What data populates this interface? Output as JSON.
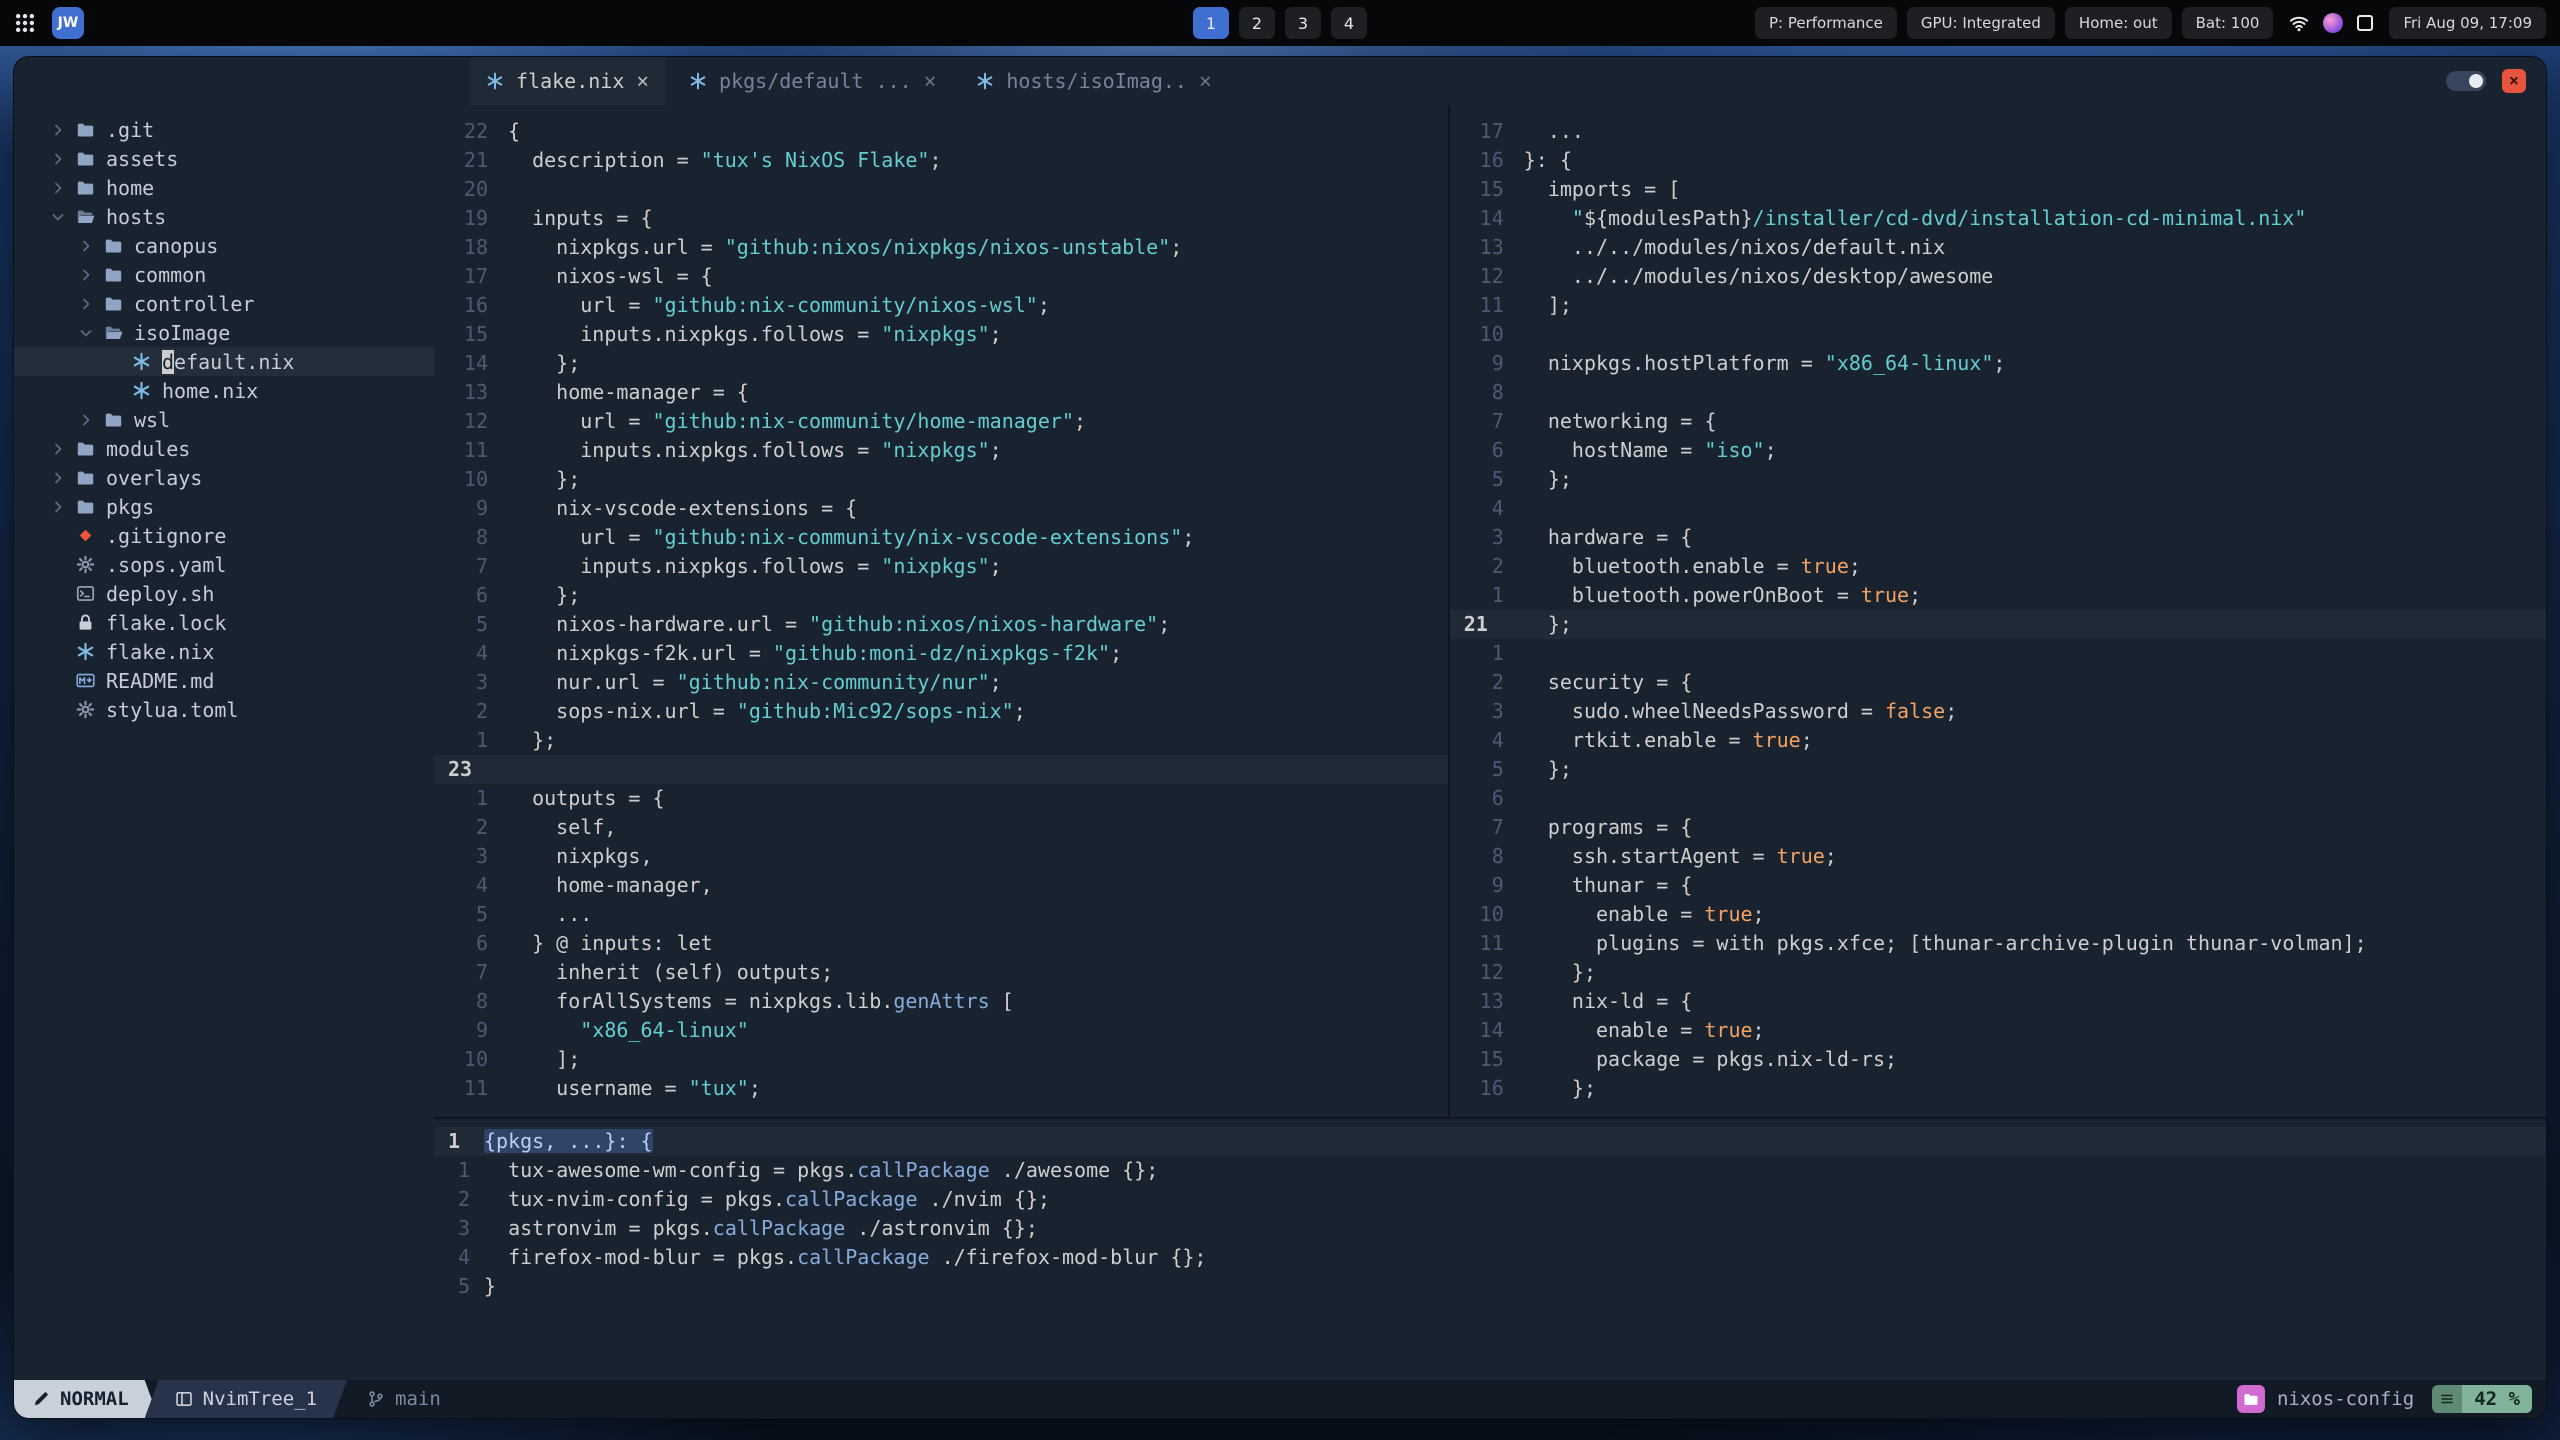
{
  "colors": {
    "string": "#63cdcf",
    "boolean": "#f4a261",
    "accent_blue": "#86abdc",
    "nix_icon": "#7ebae4",
    "mode_bg": "#c8d0da",
    "progress_bg": "#81b29a",
    "project_badge": "#d16bd1",
    "close_button": "#e8553f",
    "workspace_active": "#3f6fd1"
  },
  "topbar": {
    "launcher_label": "JW",
    "workspaces": {
      "items": [
        "1",
        "2",
        "3",
        "4"
      ],
      "active": "1"
    },
    "pills": [
      "P: Performance",
      "GPU: Integrated",
      "Home: out",
      "Bat: 100"
    ],
    "tray_icons": [
      "wifi",
      "color-badge",
      "window-outline"
    ],
    "clock": "Fri Aug 09, 17:09"
  },
  "window": {
    "close_glyph": "×",
    "tab_close_glyph": "×",
    "tabs": [
      {
        "label": "flake.nix",
        "active": true
      },
      {
        "label": "pkgs/default ...",
        "active": false
      },
      {
        "label": "hosts/isoImag..",
        "active": false
      }
    ]
  },
  "tree": {
    "items": [
      {
        "depth": 0,
        "chev": "r",
        "icon": "folder",
        "label": ".git"
      },
      {
        "depth": 0,
        "chev": "r",
        "icon": "folder",
        "label": "assets"
      },
      {
        "depth": 0,
        "chev": "r",
        "icon": "folder",
        "label": "home"
      },
      {
        "depth": 0,
        "chev": "d",
        "icon": "folder-open",
        "label": "hosts"
      },
      {
        "depth": 1,
        "chev": "r",
        "icon": "folder",
        "label": "canopus"
      },
      {
        "depth": 1,
        "chev": "r",
        "icon": "folder",
        "label": "common"
      },
      {
        "depth": 1,
        "chev": "r",
        "icon": "folder",
        "label": "controller"
      },
      {
        "depth": 1,
        "chev": "d",
        "icon": "folder-open",
        "label": "isoImage"
      },
      {
        "depth": 2,
        "chev": "",
        "icon": "nix",
        "label": "default.nix",
        "cursor": true
      },
      {
        "depth": 2,
        "chev": "",
        "icon": "nix",
        "label": "home.nix"
      },
      {
        "depth": 1,
        "chev": "r",
        "icon": "folder",
        "label": "wsl"
      },
      {
        "depth": 0,
        "chev": "r",
        "icon": "folder",
        "label": "modules"
      },
      {
        "depth": 0,
        "chev": "r",
        "icon": "folder",
        "label": "overlays"
      },
      {
        "depth": 0,
        "chev": "r",
        "icon": "folder",
        "label": "pkgs"
      },
      {
        "depth": 0,
        "chev": "",
        "icon": "git",
        "label": ".gitignore"
      },
      {
        "depth": 0,
        "chev": "",
        "icon": "gear",
        "label": ".sops.yaml"
      },
      {
        "depth": 0,
        "chev": "",
        "icon": "shell",
        "label": "deploy.sh"
      },
      {
        "depth": 0,
        "chev": "",
        "icon": "lock",
        "label": "flake.lock"
      },
      {
        "depth": 0,
        "chev": "",
        "icon": "nix",
        "label": "flake.nix"
      },
      {
        "depth": 0,
        "chev": "",
        "icon": "markdown",
        "label": "README.md"
      },
      {
        "depth": 0,
        "chev": "",
        "icon": "gear",
        "label": "stylua.toml"
      }
    ]
  },
  "editors": {
    "flake": {
      "lines": [
        [
          "22",
          0,
          [
            [
              "{",
              "fg"
            ]
          ]
        ],
        [
          "21",
          0,
          [
            [
              "  description = ",
              "fg"
            ],
            [
              "\"tux's NixOS Flake\"",
              "str"
            ],
            [
              ";",
              "fg"
            ]
          ]
        ],
        [
          "20",
          0,
          []
        ],
        [
          "19",
          0,
          [
            [
              "  inputs = {",
              "fg"
            ]
          ]
        ],
        [
          "18",
          0,
          [
            [
              "    nixpkgs.url = ",
              "fg"
            ],
            [
              "\"github:nixos/nixpkgs/nixos-unstable\"",
              "str"
            ],
            [
              ";",
              "fg"
            ]
          ]
        ],
        [
          "17",
          0,
          [
            [
              "    nixos-wsl = {",
              "fg"
            ]
          ]
        ],
        [
          "16",
          0,
          [
            [
              "      url = ",
              "fg"
            ],
            [
              "\"github:nix-community/nixos-wsl\"",
              "str"
            ],
            [
              ";",
              "fg"
            ]
          ]
        ],
        [
          "15",
          0,
          [
            [
              "      inputs.nixpkgs.follows = ",
              "fg"
            ],
            [
              "\"nixpkgs\"",
              "str"
            ],
            [
              ";",
              "fg"
            ]
          ]
        ],
        [
          "14",
          0,
          [
            [
              "    };",
              "fg"
            ]
          ]
        ],
        [
          "13",
          0,
          [
            [
              "    home-manager = {",
              "fg"
            ]
          ]
        ],
        [
          "12",
          0,
          [
            [
              "      url = ",
              "fg"
            ],
            [
              "\"github:nix-community/home-manager\"",
              "str"
            ],
            [
              ";",
              "fg"
            ]
          ]
        ],
        [
          "11",
          0,
          [
            [
              "      inputs.nixpkgs.follows = ",
              "fg"
            ],
            [
              "\"nixpkgs\"",
              "str"
            ],
            [
              ";",
              "fg"
            ]
          ]
        ],
        [
          "10",
          0,
          [
            [
              "    };",
              "fg"
            ]
          ]
        ],
        [
          "9",
          0,
          [
            [
              "    nix-vscode-extensions = {",
              "fg"
            ]
          ]
        ],
        [
          "8",
          0,
          [
            [
              "      url = ",
              "fg"
            ],
            [
              "\"github:nix-community/nix-vscode-extensions\"",
              "str"
            ],
            [
              ";",
              "fg"
            ]
          ]
        ],
        [
          "7",
          0,
          [
            [
              "      inputs.nixpkgs.follows = ",
              "fg"
            ],
            [
              "\"nixpkgs\"",
              "str"
            ],
            [
              ";",
              "fg"
            ]
          ]
        ],
        [
          "6",
          0,
          [
            [
              "    };",
              "fg"
            ]
          ]
        ],
        [
          "5",
          0,
          [
            [
              "    nixos-hardware.url = ",
              "fg"
            ],
            [
              "\"github:nixos/nixos-hardware\"",
              "str"
            ],
            [
              ";",
              "fg"
            ]
          ]
        ],
        [
          "4",
          0,
          [
            [
              "    nixpkgs-f2k.url = ",
              "fg"
            ],
            [
              "\"github:moni-dz/nixpkgs-f2k\"",
              "str"
            ],
            [
              ";",
              "fg"
            ]
          ]
        ],
        [
          "3",
          0,
          [
            [
              "    nur.url = ",
              "fg"
            ],
            [
              "\"github:nix-community/nur\"",
              "str"
            ],
            [
              ";",
              "fg"
            ]
          ]
        ],
        [
          "2",
          0,
          [
            [
              "    sops-nix.url = ",
              "fg"
            ],
            [
              "\"github:Mic92/sops-nix\"",
              "str"
            ],
            [
              ";",
              "fg"
            ]
          ]
        ],
        [
          "1",
          0,
          [
            [
              "  };",
              "fg"
            ]
          ]
        ],
        [
          "23",
          1,
          []
        ],
        [
          "1",
          0,
          [
            [
              "  outputs = {",
              "fg"
            ]
          ]
        ],
        [
          "2",
          0,
          [
            [
              "    self,",
              "fg"
            ]
          ]
        ],
        [
          "3",
          0,
          [
            [
              "    nixpkgs,",
              "fg"
            ]
          ]
        ],
        [
          "4",
          0,
          [
            [
              "    home-manager,",
              "fg"
            ]
          ]
        ],
        [
          "5",
          0,
          [
            [
              "    ...",
              "fg"
            ]
          ]
        ],
        [
          "6",
          0,
          [
            [
              "  } @ inputs: let",
              "fg"
            ]
          ]
        ],
        [
          "7",
          0,
          [
            [
              "    inherit (self) outputs;",
              "fg"
            ]
          ]
        ],
        [
          "8",
          0,
          [
            [
              "    forAllSystems = nixpkgs.lib.",
              "fg"
            ],
            [
              "genAttrs",
              "fn"
            ],
            [
              " [",
              "fg"
            ]
          ]
        ],
        [
          "9",
          0,
          [
            [
              "      ",
              "fg"
            ],
            [
              "\"x86_64-linux\"",
              "str"
            ]
          ]
        ],
        [
          "10",
          0,
          [
            [
              "    ];",
              "fg"
            ]
          ]
        ],
        [
          "11",
          0,
          [
            [
              "    username = ",
              "fg"
            ],
            [
              "\"tux\"",
              "str"
            ],
            [
              ";",
              "fg"
            ]
          ]
        ]
      ]
    },
    "iso": {
      "lines": [
        [
          "17",
          0,
          [
            [
              "  ...",
              "fg"
            ]
          ]
        ],
        [
          "16",
          0,
          [
            [
              "}: {",
              "fg"
            ]
          ]
        ],
        [
          "15",
          0,
          [
            [
              "  imports = [",
              "fg"
            ]
          ]
        ],
        [
          "14",
          0,
          [
            [
              "    ",
              "fg"
            ],
            [
              "\"",
              "str"
            ],
            [
              "${modulesPath}",
              "fg"
            ],
            [
              "/installer/cd-dvd/installation-cd-minimal.nix\"",
              "str"
            ]
          ]
        ],
        [
          "13",
          0,
          [
            [
              "    ../../modules/nixos/default.nix",
              "fg"
            ]
          ]
        ],
        [
          "12",
          0,
          [
            [
              "    ../../modules/nixos/desktop/awesome",
              "fg"
            ]
          ]
        ],
        [
          "11",
          0,
          [
            [
              "  ];",
              "fg"
            ]
          ]
        ],
        [
          "10",
          0,
          []
        ],
        [
          "9",
          0,
          [
            [
              "  nixpkgs.hostPlatform = ",
              "fg"
            ],
            [
              "\"x86_64-linux\"",
              "str"
            ],
            [
              ";",
              "fg"
            ]
          ]
        ],
        [
          "8",
          0,
          []
        ],
        [
          "7",
          0,
          [
            [
              "  networking = {",
              "fg"
            ]
          ]
        ],
        [
          "6",
          0,
          [
            [
              "    hostName = ",
              "fg"
            ],
            [
              "\"iso\"",
              "str"
            ],
            [
              ";",
              "fg"
            ]
          ]
        ],
        [
          "5",
          0,
          [
            [
              "  };",
              "fg"
            ]
          ]
        ],
        [
          "4",
          0,
          []
        ],
        [
          "3",
          0,
          [
            [
              "  hardware = {",
              "fg"
            ]
          ]
        ],
        [
          "2",
          0,
          [
            [
              "    bluetooth.enable = ",
              "fg"
            ],
            [
              "true",
              "bool"
            ],
            [
              ";",
              "fg"
            ]
          ]
        ],
        [
          "1",
          0,
          [
            [
              "    bluetooth.powerOnBoot = ",
              "fg"
            ],
            [
              "true",
              "bool"
            ],
            [
              ";",
              "fg"
            ]
          ]
        ],
        [
          "21",
          1,
          [
            [
              "  };",
              "fg"
            ]
          ]
        ],
        [
          "1",
          0,
          []
        ],
        [
          "2",
          0,
          [
            [
              "  security = {",
              "fg"
            ]
          ]
        ],
        [
          "3",
          0,
          [
            [
              "    sudo.wheelNeedsPassword = ",
              "fg"
            ],
            [
              "false",
              "bool"
            ],
            [
              ";",
              "fg"
            ]
          ]
        ],
        [
          "4",
          0,
          [
            [
              "    rtkit.enable = ",
              "fg"
            ],
            [
              "true",
              "bool"
            ],
            [
              ";",
              "fg"
            ]
          ]
        ],
        [
          "5",
          0,
          [
            [
              "  };",
              "fg"
            ]
          ]
        ],
        [
          "6",
          0,
          []
        ],
        [
          "7",
          0,
          [
            [
              "  programs = {",
              "fg"
            ]
          ]
        ],
        [
          "8",
          0,
          [
            [
              "    ssh.startAgent = ",
              "fg"
            ],
            [
              "true",
              "bool"
            ],
            [
              ";",
              "fg"
            ]
          ]
        ],
        [
          "9",
          0,
          [
            [
              "    thunar = {",
              "fg"
            ]
          ]
        ],
        [
          "10",
          0,
          [
            [
              "      enable = ",
              "fg"
            ],
            [
              "true",
              "bool"
            ],
            [
              ";",
              "fg"
            ]
          ]
        ],
        [
          "11",
          0,
          [
            [
              "      plugins = with pkgs.xfce; [thunar-archive-plugin thunar-volman];",
              "fg"
            ]
          ]
        ],
        [
          "12",
          0,
          [
            [
              "    };",
              "fg"
            ]
          ]
        ],
        [
          "13",
          0,
          [
            [
              "    nix-ld = {",
              "fg"
            ]
          ]
        ],
        [
          "14",
          0,
          [
            [
              "      enable = ",
              "fg"
            ],
            [
              "true",
              "bool"
            ],
            [
              ";",
              "fg"
            ]
          ]
        ],
        [
          "15",
          0,
          [
            [
              "      package = pkgs.nix-ld-rs;",
              "fg"
            ]
          ]
        ],
        [
          "16",
          0,
          [
            [
              "    };",
              "fg"
            ]
          ]
        ]
      ]
    },
    "pkgs": {
      "lines": [
        [
          "1",
          1,
          [
            [
              "{pkgs, ...}: {",
              "sel"
            ]
          ]
        ],
        [
          "1",
          0,
          [
            [
              "  tux-awesome-wm-config = pkgs.",
              "fg"
            ],
            [
              "callPackage",
              "fn"
            ],
            [
              " ./awesome {};",
              "fg"
            ]
          ]
        ],
        [
          "2",
          0,
          [
            [
              "  tux-nvim-config = pkgs.",
              "fg"
            ],
            [
              "callPackage",
              "fn"
            ],
            [
              " ./nvim {};",
              "fg"
            ]
          ]
        ],
        [
          "3",
          0,
          [
            [
              "  astronvim = pkgs.",
              "fg"
            ],
            [
              "callPackage",
              "fn"
            ],
            [
              " ./astronvim {};",
              "fg"
            ]
          ]
        ],
        [
          "4",
          0,
          [
            [
              "  firefox-mod-blur = pkgs.",
              "fg"
            ],
            [
              "callPackage",
              "fn"
            ],
            [
              " ./firefox-mod-blur {};",
              "fg"
            ]
          ]
        ],
        [
          "5",
          0,
          [
            [
              "}",
              "fg"
            ]
          ]
        ]
      ]
    }
  },
  "statusline": {
    "mode": "NORMAL",
    "buffer": "NvimTree_1",
    "branch": "main",
    "project": "nixos-config",
    "progress": "42 %"
  }
}
